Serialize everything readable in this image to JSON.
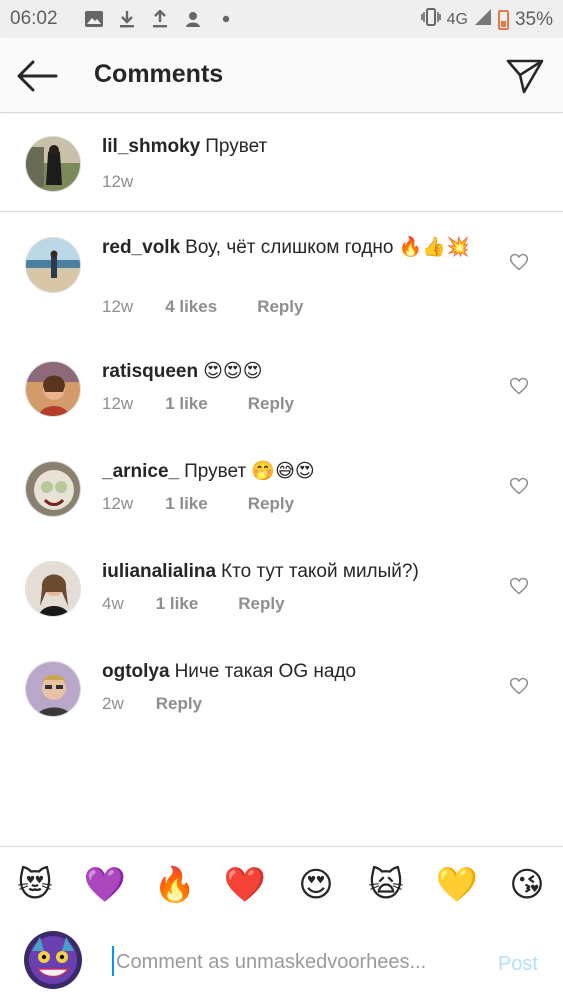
{
  "status_bar": {
    "time": "06:02",
    "network": "4G",
    "battery": "35%"
  },
  "header": {
    "title": "Comments"
  },
  "comments": [
    {
      "user": "lil_shmoky",
      "text": "Прувет",
      "time": "12w",
      "likes": "",
      "reply": ""
    },
    {
      "user": "red_volk",
      "text": "Воу, чёт слишком годно 🔥👍💥",
      "time": "12w",
      "likes": "4 likes",
      "reply": "Reply"
    },
    {
      "user": "ratisqueen",
      "text": "😍😍😍",
      "time": "12w",
      "likes": "1 like",
      "reply": "Reply"
    },
    {
      "user": "_arnice_",
      "text": "Прувет 🤭😅😍",
      "time": "12w",
      "likes": "1 like",
      "reply": "Reply"
    },
    {
      "user": "iulianalialina",
      "text": "Кто тут такой милый?)",
      "time": "4w",
      "likes": "1 like",
      "reply": "Reply"
    },
    {
      "user": "ogtolya",
      "text": "Ниче такая OG надо",
      "time": "2w",
      "likes": "",
      "reply": "Reply"
    }
  ],
  "emoji_bar": [
    "😻",
    "💜",
    "🔥",
    "❤️",
    "😍",
    "🙀",
    "💛",
    "😘"
  ],
  "input": {
    "placeholder": "Comment as unmaskedvoorhees...",
    "post_label": "Post"
  },
  "icons": {
    "back": "arrow-left-icon",
    "share": "paper-plane-icon",
    "like": "heart-outline-icon"
  },
  "colors": {
    "accent": "#0095f6",
    "post_disabled": "#b2dffc",
    "meta": "#8e8e8e"
  }
}
